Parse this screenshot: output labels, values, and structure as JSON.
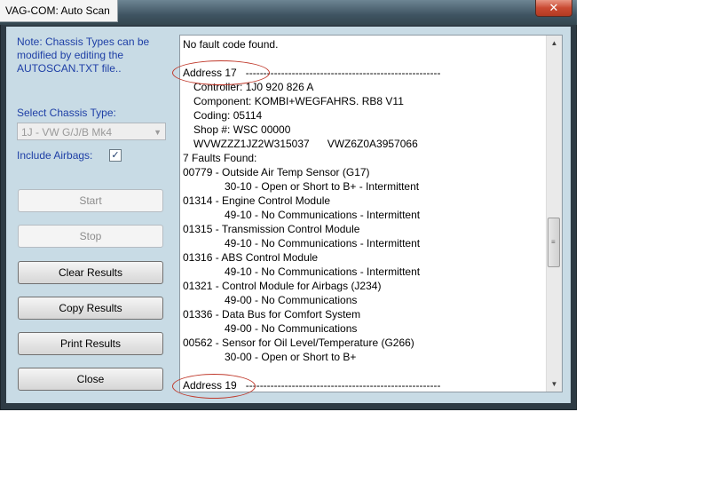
{
  "window": {
    "title": "VAG-COM: Auto Scan",
    "close_glyph": "✕"
  },
  "sidebar": {
    "note": "Note:  Chassis Types can be modified by editing the AUTOSCAN.TXT file..",
    "select_label": "Select Chassis Type:",
    "select_value": "1J - VW G/J/B Mk4",
    "include_airbags_label": "Include Airbags:",
    "include_airbags_checked": true,
    "check_glyph": "✓",
    "buttons": {
      "start": "Start",
      "stop": "Stop",
      "clear": "Clear Results",
      "copy": "Copy Results",
      "print": "Print Results",
      "close": "Close"
    }
  },
  "results": {
    "lines": [
      "No fault code found.",
      "",
      "Address 17   -------------------------------------------------------",
      "Controller: 1J0 920 826 A",
      "Component: KOMBI+WEGFAHRS. RB8 V11",
      "Coding: 05114",
      "Shop #: WSC 00000",
      "WVWZZZ1JZ2W315037      VWZ6Z0A3957066",
      "7 Faults Found:",
      "00779 - Outside Air Temp Sensor (G17)",
      "30-10 - Open or Short to B+ - Intermittent",
      "01314 - Engine Control Module",
      "49-10 - No Communications - Intermittent",
      "01315 - Transmission Control Module",
      "49-10 - No Communications - Intermittent",
      "01316 - ABS Control Module",
      "49-10 - No Communications - Intermittent",
      "01321 - Control Module for Airbags (J234)",
      "49-00 - No Communications",
      "01336 - Data Bus for Comfort System",
      "49-00 - No Communications",
      "00562 - Sensor for Oil Level/Temperature (G266)",
      "30-00 - Open or Short to B+",
      "",
      "Address 19   -------------------------------------------------------"
    ],
    "indent": [
      0,
      0,
      0,
      1,
      1,
      1,
      1,
      1,
      0,
      0,
      2,
      0,
      2,
      0,
      2,
      0,
      2,
      0,
      2,
      0,
      2,
      0,
      2,
      0,
      0
    ]
  },
  "scrollbar": {
    "up_glyph": "▲",
    "down_glyph": "▼",
    "grip_glyph": "≡"
  },
  "colors": {
    "annotation": "#c0392b",
    "label_blue": "#1e3fa6"
  }
}
